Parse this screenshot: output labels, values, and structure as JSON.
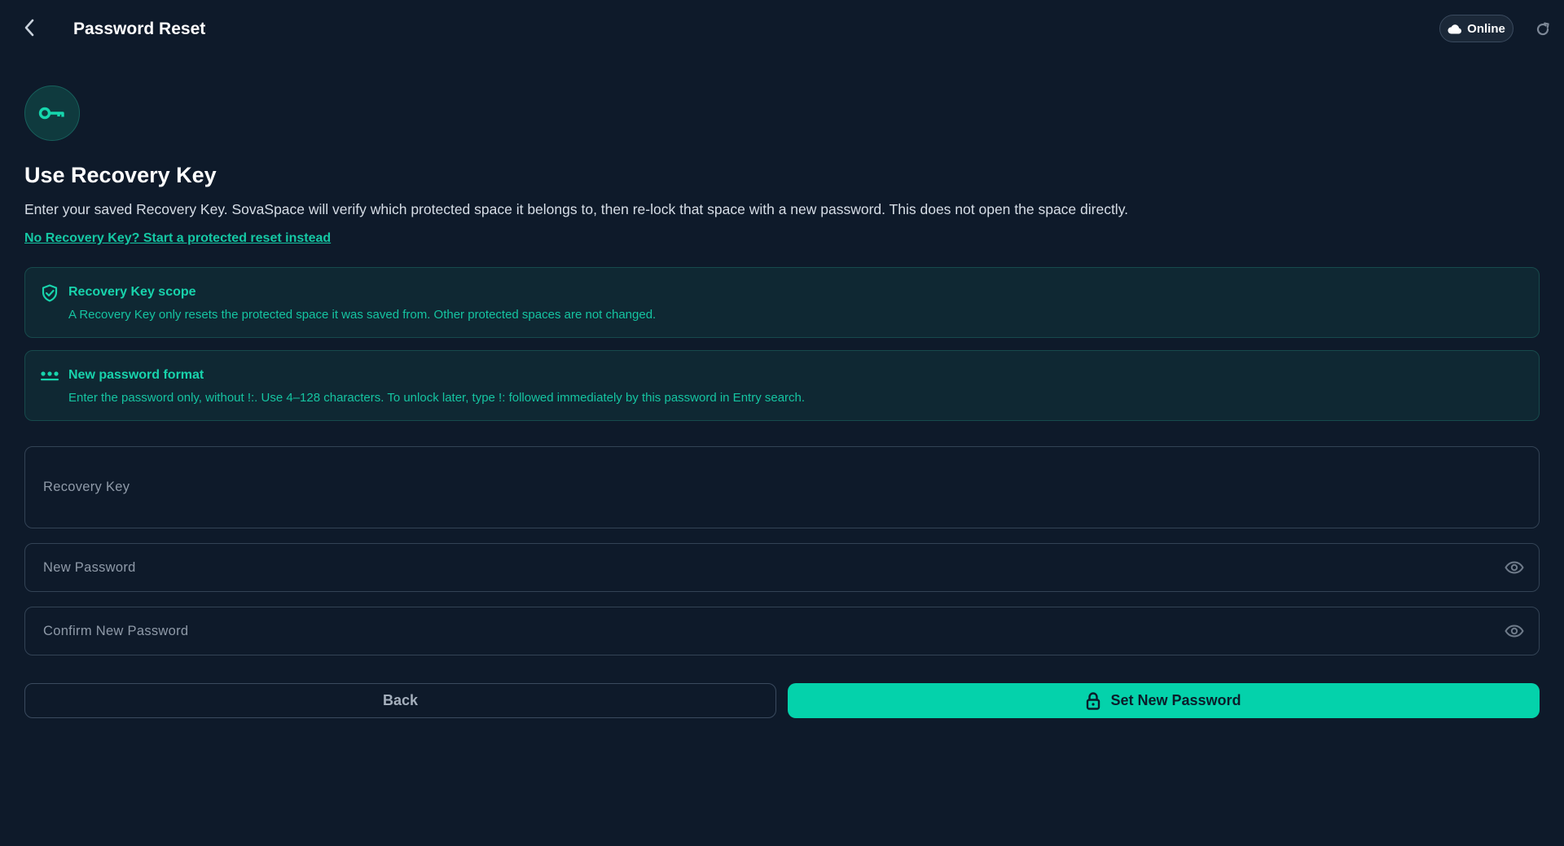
{
  "header": {
    "title": "Password Reset",
    "status_label": "Online"
  },
  "main": {
    "heading": "Use Recovery Key",
    "description": "Enter your saved Recovery Key. SovaSpace will verify which protected space it belongs to, then re-lock that space with a new password. This does not open the space directly.",
    "alt_link": "No Recovery Key? Start a protected reset instead"
  },
  "cards": [
    {
      "title": "Recovery Key scope",
      "text": "A Recovery Key only resets the protected space it was saved from. Other protected spaces are not changed.",
      "icon": "shield-check-icon"
    },
    {
      "title": "New password format",
      "text": "Enter the password only, without !:. Use 4–128 characters. To unlock later, type !: followed immediately by this password in Entry search.",
      "icon": "password-dots-icon"
    }
  ],
  "form": {
    "recovery_key": {
      "placeholder": "Recovery Key",
      "value": ""
    },
    "new_password": {
      "placeholder": "New Password",
      "value": ""
    },
    "confirm_password": {
      "placeholder": "Confirm New Password",
      "value": ""
    }
  },
  "actions": {
    "back_label": "Back",
    "submit_label": "Set New Password"
  },
  "colors": {
    "background": "#0e1a2a",
    "accent": "#04d2ab",
    "card_background": "#0f2833",
    "card_text": "#15c4a1"
  }
}
